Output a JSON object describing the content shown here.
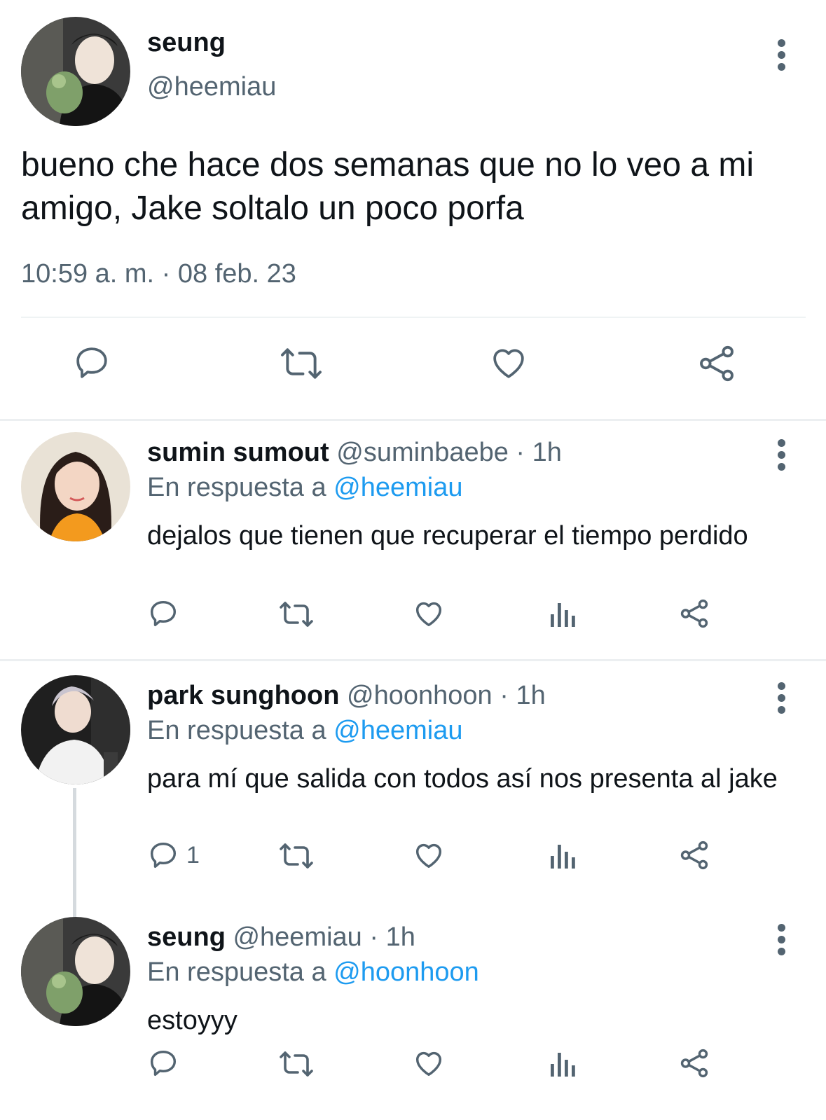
{
  "main_tweet": {
    "name": "seung",
    "handle": "@heemiau",
    "text": "bueno che hace dos semanas que no lo veo a mi amigo, Jake soltalo un poco porfa",
    "timestamp": "10:59 a. m. · 08 feb. 23",
    "actions": [
      "reply-icon",
      "retweet-icon",
      "like-icon",
      "share-icon"
    ]
  },
  "replies": [
    {
      "name": "sumin sumout",
      "handle": "@suminbaebe",
      "time": "· 1h",
      "reply_prefix": "En respuesta a",
      "reply_to": "@heemiau",
      "text": "dejalos que tienen que recuperar el tiempo perdido",
      "reply_count": ""
    },
    {
      "name": "park sunghoon",
      "handle": "@hoonhoon",
      "time": "· 1h",
      "reply_prefix": "En respuesta a",
      "reply_to": "@heemiau",
      "text": "para mí que salida con todos así nos presenta al jake",
      "reply_count": "1"
    },
    {
      "name": "seung",
      "handle": "@heemiau",
      "time": "· 1h",
      "reply_prefix": "En respuesta a",
      "reply_to": "@hoonhoon",
      "text": "estoyyy",
      "reply_count": ""
    }
  ],
  "colors": {
    "text": "#0f1419",
    "secondary": "#536471",
    "accent": "#1d9bf0",
    "divider": "#eceff1"
  }
}
